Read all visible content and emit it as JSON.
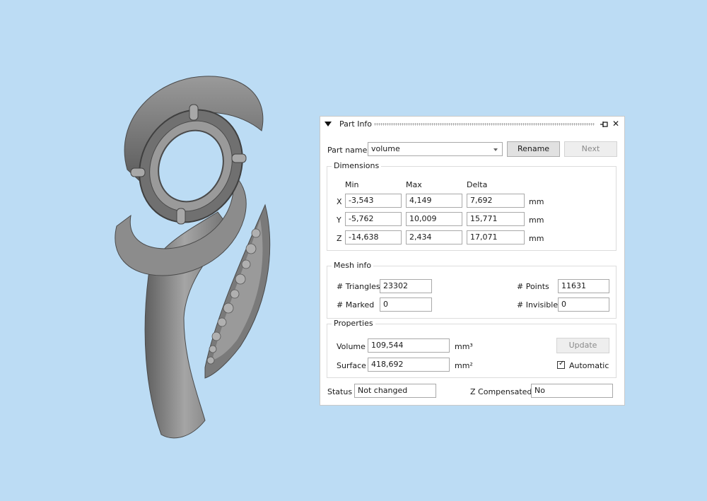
{
  "panel": {
    "title": "Part Info",
    "part_name_label": "Part name",
    "part_name_value": "volume",
    "rename_label": "Rename",
    "next_label": "Next"
  },
  "dimensions": {
    "title": "Dimensions",
    "headers": {
      "min": "Min",
      "max": "Max",
      "delta": "Delta"
    },
    "unit": "mm",
    "rows": [
      {
        "axis": "X",
        "min": "-3,543",
        "max": "4,149",
        "delta": "7,692"
      },
      {
        "axis": "Y",
        "min": "-5,762",
        "max": "10,009",
        "delta": "15,771"
      },
      {
        "axis": "Z",
        "min": "-14,638",
        "max": "2,434",
        "delta": "17,071"
      }
    ]
  },
  "mesh_info": {
    "title": "Mesh info",
    "triangles_label": "# Triangles",
    "triangles_value": "23302",
    "points_label": "# Points",
    "points_value": "11631",
    "marked_label": "# Marked",
    "marked_value": "0",
    "invisible_label": "# Invisible",
    "invisible_value": "0"
  },
  "properties": {
    "title": "Properties",
    "volume_label": "Volume",
    "volume_value": "109,544",
    "volume_unit": "mm³",
    "surface_label": "Surface",
    "surface_value": "418,692",
    "surface_unit": "mm²",
    "update_label": "Update",
    "automatic_label": "Automatic",
    "automatic_checked": true
  },
  "footer": {
    "status_label": "Status",
    "status_value": "Not changed",
    "z_comp_label": "Z Compensated",
    "z_comp_value": "No"
  },
  "colors": {
    "viewport_background": "#bcdcf4",
    "model_gray": "#8c8c8c"
  }
}
